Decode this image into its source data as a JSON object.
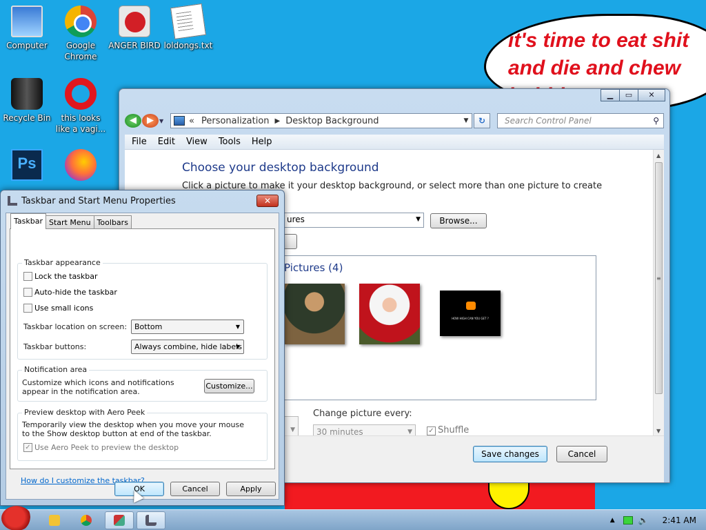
{
  "desktop": {
    "icons": [
      {
        "label": "Computer"
      },
      {
        "label": "Google Chrome"
      },
      {
        "label": "ANGER BIRD"
      },
      {
        "label": "loldongs.txt"
      },
      {
        "label": "Recycle Bin"
      },
      {
        "label": "this looks like a vagi..."
      },
      {
        "label": ""
      },
      {
        "label": ""
      }
    ],
    "bubble_line1": "it's time to eat shit",
    "bubble_line2": "and die and chew",
    "bubble_line3": "bubble gum"
  },
  "control_panel": {
    "breadcrumb_root": "«",
    "breadcrumb_1": "Personalization",
    "breadcrumb_2": "Desktop Background",
    "search_placeholder": "Search Control Panel",
    "menu": [
      "File",
      "Edit",
      "View",
      "Tools",
      "Help"
    ],
    "title": "Choose your desktop background",
    "description": "Click a picture to make it your desktop background, or select more than one picture to create a slide",
    "location_value": "ures",
    "browse_label": "Browse...",
    "pictures_header": "Pictures (4)",
    "change_picture_label": "Change picture every:",
    "change_picture_value": "30 minutes",
    "shuffle_label": "Shuffle",
    "save_label": "Save changes",
    "cancel_label": "Cancel",
    "thumb3_text": "HOW HIGH CAN YOU GET ?"
  },
  "dialog": {
    "title": "Taskbar and Start Menu Properties",
    "tabs": [
      "Taskbar",
      "Start Menu",
      "Toolbars"
    ],
    "appearance_title": "Taskbar appearance",
    "lock": "Lock the taskbar",
    "autohide": "Auto-hide the taskbar",
    "small_icons": "Use small icons",
    "location_label": "Taskbar location on screen:",
    "location_value": "Bottom",
    "buttons_label": "Taskbar buttons:",
    "buttons_value": "Always combine, hide labels",
    "notif_title": "Notification area",
    "notif_text": "Customize which icons and notifications appear in the notification area.",
    "customize_label": "Customize...",
    "peek_title": "Preview desktop with Aero Peek",
    "peek_text": "Temporarily view the desktop when you move your mouse to the Show desktop button at end of the taskbar.",
    "peek_check": "Use Aero Peek to preview the desktop",
    "help_link": "How do I customize the taskbar?",
    "ok": "OK",
    "cancel": "Cancel",
    "apply": "Apply"
  },
  "taskbar": {
    "clock": "2:41 AM"
  },
  "colors": {
    "desktop": "#1ba7e6",
    "title_blue": "#1e3a8a",
    "bubble_red": "#e0101c"
  }
}
